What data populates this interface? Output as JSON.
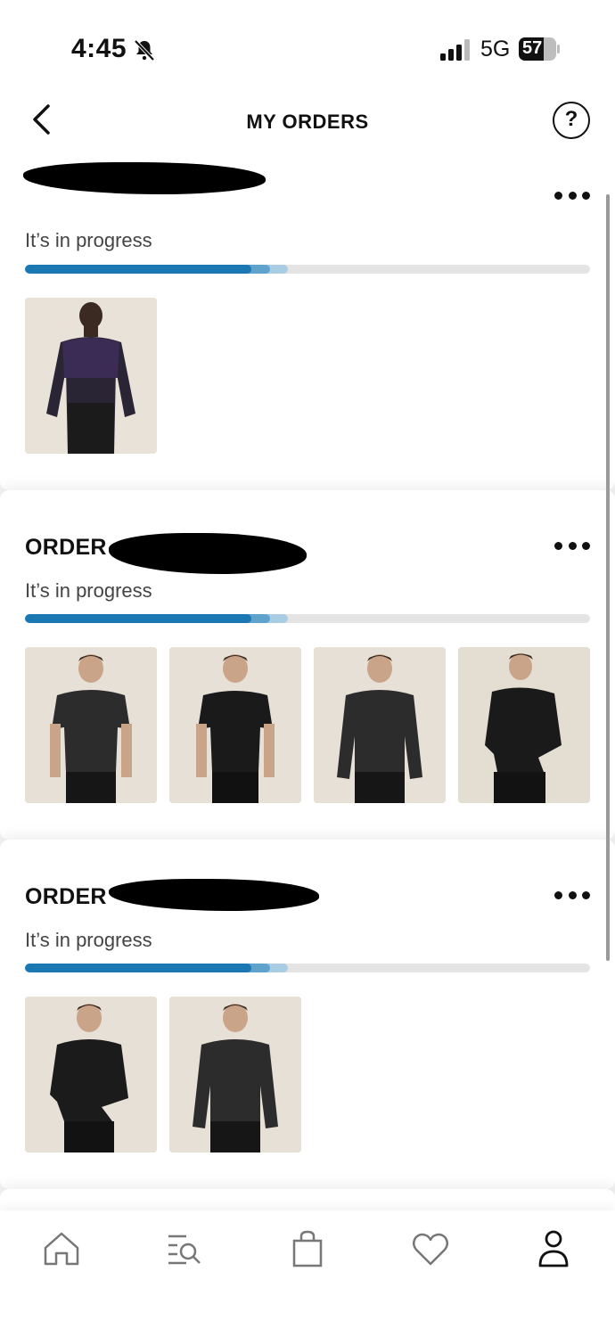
{
  "status_bar": {
    "time": "4:45",
    "network": "5G",
    "battery": "57"
  },
  "header": {
    "title": "MY ORDERS",
    "help": "?"
  },
  "orders": [
    {
      "title": "",
      "status": "It’s in progress",
      "progress": 0.47,
      "items": 1
    },
    {
      "title": "ORDER",
      "status": "It’s in progress",
      "progress": 0.47,
      "items": 4
    },
    {
      "title": "ORDER",
      "status": "It’s in progress",
      "progress": 0.47,
      "items": 2
    }
  ],
  "colors": {
    "progress_fill": "#1b78b2",
    "progress_track": "#e4e4e4",
    "thumb_bg": "#e9e4dc"
  },
  "nav": [
    {
      "icon": "home-icon"
    },
    {
      "icon": "search-list-icon"
    },
    {
      "icon": "bag-icon"
    },
    {
      "icon": "heart-icon"
    },
    {
      "icon": "account-icon"
    }
  ]
}
